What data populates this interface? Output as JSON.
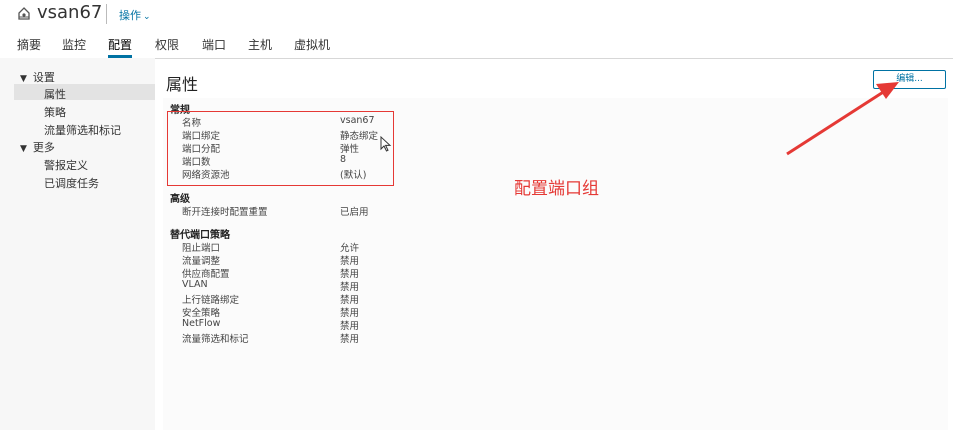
{
  "header": {
    "title": "vsan67",
    "actions_label": "操作"
  },
  "tabs": [
    "摘要",
    "监控",
    "配置",
    "权限",
    "端口",
    "主机",
    "虚拟机"
  ],
  "sidebar": {
    "group1": "设置",
    "items1": [
      "属性",
      "策略",
      "流量筛选和标记"
    ],
    "group2": "更多",
    "items2": [
      "警报定义",
      "已调度任务"
    ]
  },
  "main": {
    "title": "属性",
    "edit_label": "编辑...",
    "general": {
      "heading": "常规",
      "rows": [
        {
          "k": "名称",
          "v": "vsan67"
        },
        {
          "k": "端口绑定",
          "v": "静态绑定"
        },
        {
          "k": "端口分配",
          "v": "弹性"
        },
        {
          "k": "端口数",
          "v": "8"
        },
        {
          "k": "网络资源池",
          "v": "(默认)"
        }
      ]
    },
    "advanced": {
      "heading": "高级",
      "rows": [
        {
          "k": "断开连接时配置重置",
          "v": "已启用"
        }
      ]
    },
    "override": {
      "heading": "替代端口策略",
      "rows": [
        {
          "k": "阻止端口",
          "v": "允许"
        },
        {
          "k": "流量调整",
          "v": "禁用"
        },
        {
          "k": "供应商配置",
          "v": "禁用"
        },
        {
          "k": "VLAN",
          "v": "禁用"
        },
        {
          "k": "上行链路绑定",
          "v": "禁用"
        },
        {
          "k": "安全策略",
          "v": "禁用"
        },
        {
          "k": "NetFlow",
          "v": "禁用"
        },
        {
          "k": "流量筛选和标记",
          "v": "禁用"
        }
      ]
    }
  },
  "annotation": {
    "text": "配置端口组",
    "color": "#e53935"
  },
  "colors": {
    "accent": "#0072a3"
  }
}
